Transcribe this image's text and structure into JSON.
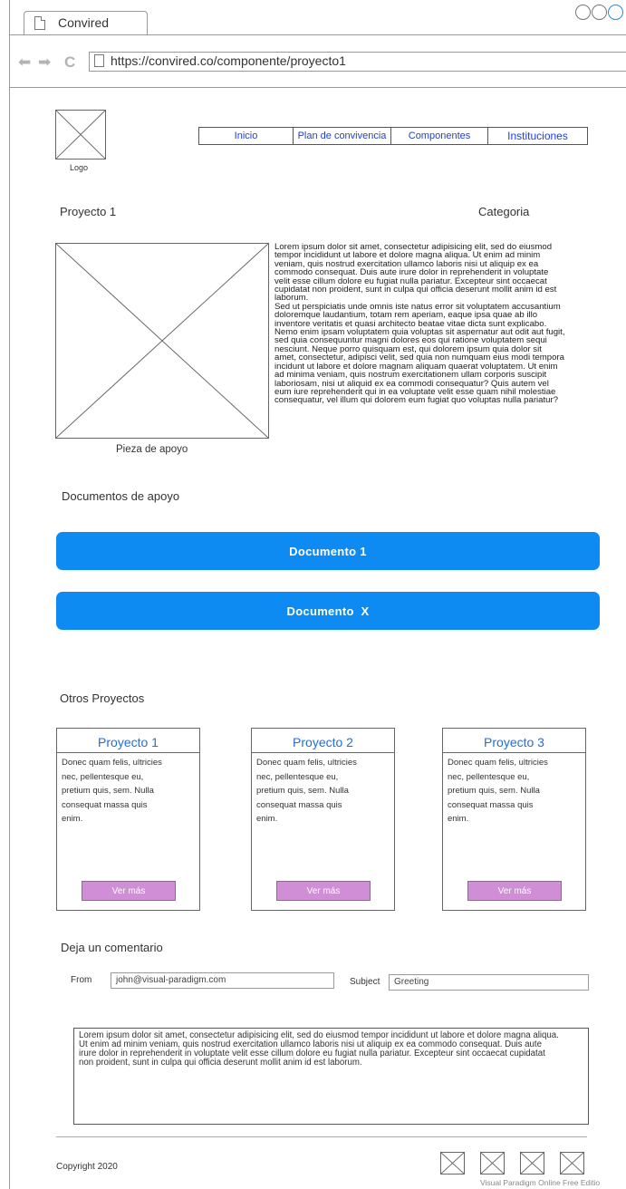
{
  "browser": {
    "tab_title": "Convired",
    "url": "https://convired.co/componente/proyecto1"
  },
  "header": {
    "logo_label": "Logo",
    "nav": [
      "Inicio",
      "Plan de convivencia",
      "Componentes",
      "Instituciones"
    ]
  },
  "project": {
    "title": "Proyecto 1",
    "category": "Categoria",
    "image_caption": "Pieza de apoyo",
    "description": "Lorem ipsum dolor sit amet, consectetur adipisicing elit, sed do eiusmod\ntempor incididunt ut labore et dolore magna aliqua. Ut enim ad minim\nveniam, quis nostrud exercitation ullamco laboris nisi ut aliquip ex ea\ncommodo consequat. Duis aute irure dolor in reprehenderit in voluptate\nvelit esse cillum dolore eu fugiat nulla pariatur. Excepteur sint occaecat\ncupidatat non proident, sunt in culpa qui officia deserunt mollit anim id est\nlaborum.\nSed ut perspiciatis unde omnis iste natus error sit voluptatem accusantium\ndoloremque laudantium, totam rem aperiam, eaque ipsa quae ab illo\ninventore veritatis et quasi architecto beatae vitae dicta sunt explicabo.\nNemo enim ipsam voluptatem quia voluptas sit aspernatur aut odit aut fugit,\nsed quia consequuntur magni dolores eos qui ratione voluptatem sequi\nnesciunt. Neque porro quisquam est, qui dolorem ipsum quia dolor sit\namet, consectetur, adipisci velit, sed quia non numquam eius modi tempora\nincidunt ut labore et dolore magnam aliquam quaerat voluptatem. Ut enim\nad minima veniam, quis nostrum exercitationem ullam corporis suscipit\nlaboriosam, nisi ut aliquid ex ea commodi consequatur? Quis autem vel\neum iure reprehenderit qui in ea voluptate velit esse quam nihil molestiae\nconsequatur, vel illum qui dolorem eum fugiat quo voluptas nulla pariatur?"
  },
  "documents": {
    "heading": "Documentos de apoyo",
    "buttons": [
      "Documento 1",
      "Documento  X"
    ]
  },
  "others": {
    "heading": "Otros Proyectos",
    "cards": [
      {
        "title": "Proyecto 1",
        "body": "Donec quam felis, ultricies\nnec, pellentesque eu,\npretium quis, sem. Nulla\nconsequat massa quis\nenim.",
        "button": "Ver más"
      },
      {
        "title": "Proyecto 2",
        "body": "Donec quam felis, ultricies\nnec, pellentesque eu,\npretium quis, sem. Nulla\nconsequat massa quis\nenim.",
        "button": "Ver más"
      },
      {
        "title": "Proyecto 3",
        "body": "Donec quam felis, ultricies\nnec, pellentesque eu,\npretium quis, sem. Nulla\nconsequat massa quis\nenim.",
        "button": "Ver más"
      }
    ]
  },
  "comment": {
    "heading": "Deja un comentario",
    "from_label": "From",
    "from_value": "john@visual-paradigm.com",
    "subject_label": "Subject",
    "subject_value": "Greeting",
    "message": "Lorem ipsum dolor sit amet, consectetur adipisicing elit, sed do eiusmod tempor incididunt ut labore et dolore magna aliqua.\nUt enim ad minim veniam, quis nostrud exercitation ullamco laboris nisi ut aliquip ex ea commodo consequat. Duis aute\nirure dolor in reprehenderit in voluptate velit esse cillum dolore eu fugiat nulla pariatur. Excepteur sint occaecat cupidatat\nnon proident, sunt in culpa qui officia deserunt mollit anim id est laborum."
  },
  "footer": {
    "copyright": "Copyright 2020",
    "watermark": "Visual Paradigm Online Free Editio"
  },
  "colors": {
    "nav_link": "#1f3fd6",
    "doc_button": "#0d8bf2",
    "card_title": "#1f6fe0",
    "card_button": "#cf8ed6"
  }
}
